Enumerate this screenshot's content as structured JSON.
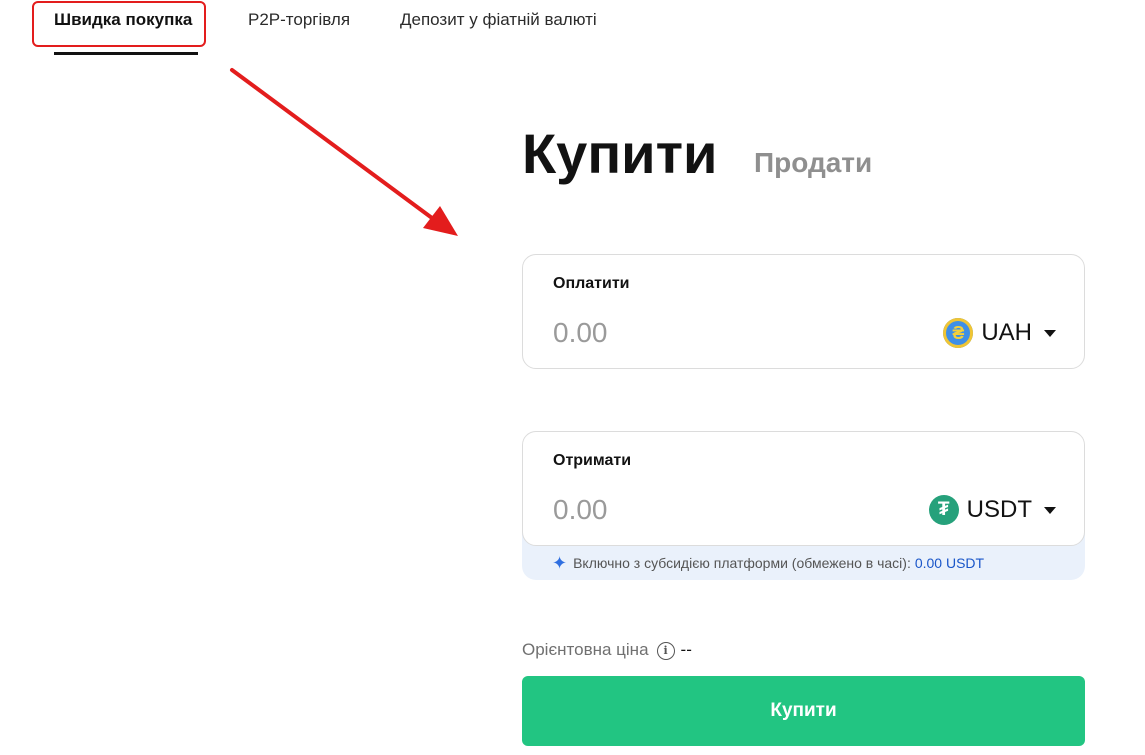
{
  "tabs": {
    "quick_buy": "Швидка покупка",
    "p2p": "P2P-торгівля",
    "fiat_deposit": "Депозит у фіатній валюті"
  },
  "mode": {
    "buy": "Купити",
    "sell": "Продати"
  },
  "pay": {
    "label": "Оплатити",
    "placeholder": "0.00",
    "currency": "UAH",
    "icon": "hryvnia-coin-icon",
    "coin_glyph": "₴"
  },
  "receive": {
    "label": "Отримати",
    "placeholder": "0.00",
    "currency": "USDT",
    "icon": "tether-coin-icon",
    "coin_glyph": "₮"
  },
  "subsidy": {
    "text": "Включно з субсидією платформи (обмежено в часі):",
    "value": "0.00 USDT"
  },
  "price": {
    "label": "Орієнтовна ціна",
    "value": "--"
  },
  "buy_button": {
    "label": "Купити"
  },
  "colors": {
    "accent_green": "#22c582",
    "annotation_red": "#e31d1d",
    "subsidy_blue": "#1a56c9"
  }
}
